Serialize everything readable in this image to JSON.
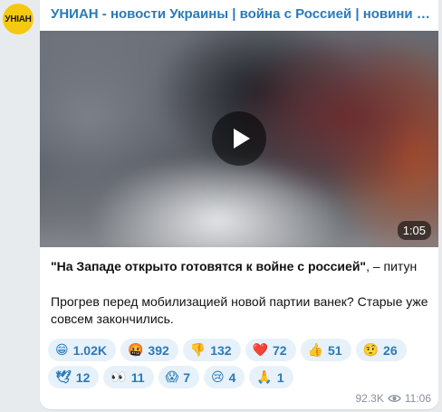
{
  "channel": {
    "name": "УНИАН - новости Украины | война с Россией | новини Украіни...",
    "avatar_text": "УНIАН"
  },
  "video": {
    "duration": "1:05"
  },
  "message": {
    "quote": "\"На Западе открыто готовятся к войне с россией\"",
    "quote_suffix": ", – питун",
    "body": "Прогрев перед мобилизацией новой партии ванек? Старые уже совсем закончились."
  },
  "reactions": [
    {
      "emoji": "😁",
      "count": "1.02K"
    },
    {
      "emoji": "🤬",
      "count": "392"
    },
    {
      "emoji": "👎",
      "count": "132"
    },
    {
      "emoji": "❤️",
      "count": "72"
    },
    {
      "emoji": "👍",
      "count": "51"
    },
    {
      "emoji": "🤨",
      "count": "26"
    },
    {
      "emoji": "🕊",
      "count": "12"
    },
    {
      "emoji": "👀",
      "count": "11"
    },
    {
      "emoji": "😱",
      "count": "7"
    },
    {
      "emoji": "😢",
      "count": "4"
    },
    {
      "emoji": "🙏",
      "count": "1"
    }
  ],
  "meta": {
    "views": "92.3K",
    "time": "11:06",
    "views_icon": "eye-icon"
  }
}
